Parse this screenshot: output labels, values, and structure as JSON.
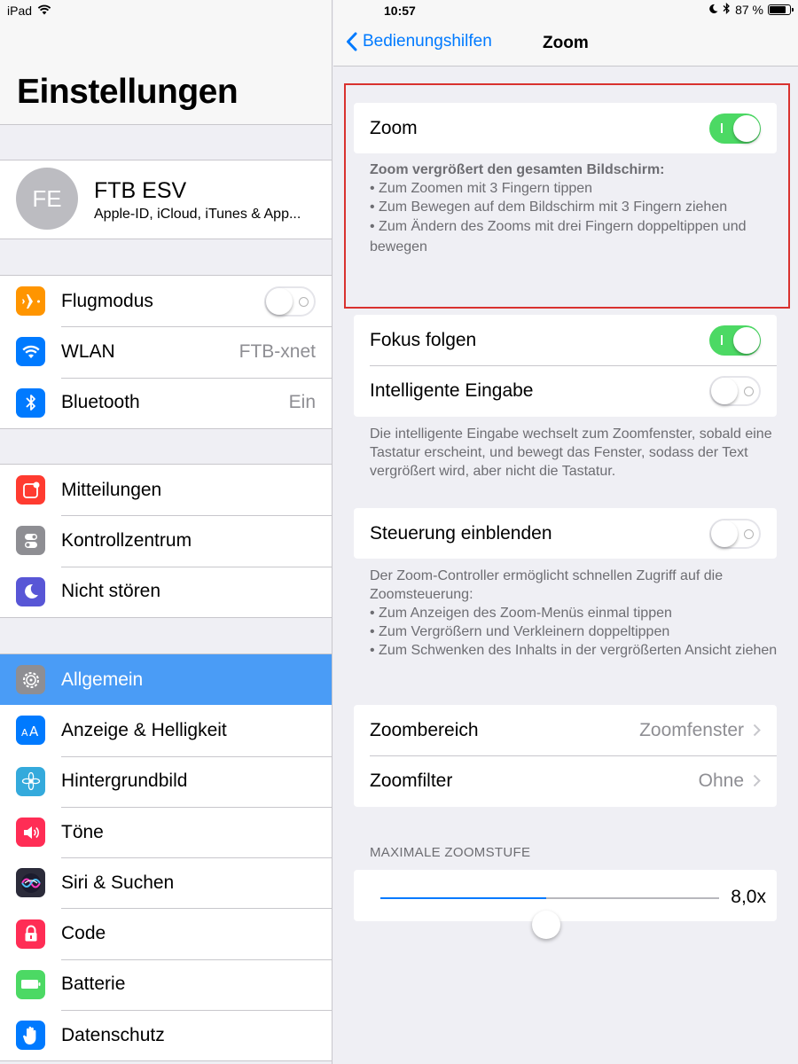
{
  "status_bar": {
    "device": "iPad",
    "time": "10:57",
    "battery_text": "87 %",
    "battery_level": 0.87
  },
  "sidebar": {
    "title": "Einstellungen",
    "profile": {
      "initials": "FE",
      "name": "FTB ESV",
      "subtitle": "Apple-ID, iCloud, iTunes & App..."
    },
    "group1": [
      {
        "label": "Flugmodus",
        "icon": "airplane-icon",
        "color": "#ff9500",
        "toggle": false
      },
      {
        "label": "WLAN",
        "icon": "wifi-icon",
        "color": "#007aff",
        "value": "FTB-xnet"
      },
      {
        "label": "Bluetooth",
        "icon": "bluetooth-icon",
        "color": "#007aff",
        "value": "Ein"
      }
    ],
    "group2": [
      {
        "label": "Mitteilungen",
        "icon": "notifications-icon",
        "color": "#ff3b30"
      },
      {
        "label": "Kontrollzentrum",
        "icon": "control-center-icon",
        "color": "#8e8e93"
      },
      {
        "label": "Nicht stören",
        "icon": "moon-icon",
        "color": "#5856d6"
      }
    ],
    "group3": [
      {
        "label": "Allgemein",
        "icon": "gear-icon",
        "color": "#8e8e93",
        "selected": true
      },
      {
        "label": "Anzeige & Helligkeit",
        "icon": "text-size-icon",
        "color": "#007aff"
      },
      {
        "label": "Hintergrundbild",
        "icon": "flower-icon",
        "color": "#34aadc"
      },
      {
        "label": "Töne",
        "icon": "speaker-icon",
        "color": "#ff2d55"
      },
      {
        "label": "Siri & Suchen",
        "icon": "siri-icon",
        "color": "#2b2b3a"
      },
      {
        "label": "Code",
        "icon": "lock-icon",
        "color": "#ff2d55"
      },
      {
        "label": "Batterie",
        "icon": "battery-icon",
        "color": "#4cd964"
      },
      {
        "label": "Datenschutz",
        "icon": "hand-icon",
        "color": "#007aff"
      }
    ]
  },
  "detail": {
    "back_label": "Bedienungshilfen",
    "title": "Zoom",
    "zoom_row": {
      "label": "Zoom",
      "on": true
    },
    "zoom_footnote": {
      "heading": "Zoom vergrößert den gesamten Bildschirm:",
      "lines": [
        "• Zum Zoomen mit 3 Fingern tippen",
        "• Zum Bewegen auf dem Bildschirm mit 3 Fingern ziehen",
        "• Zum Ändern des Zooms mit drei Fingern doppeltippen und bewegen"
      ]
    },
    "focus_row": {
      "label": "Fokus folgen",
      "on": true
    },
    "smart_typing_row": {
      "label": "Intelligente Eingabe",
      "on": false
    },
    "smart_typing_footnote": "Die intelligente Eingabe wechselt zum Zoomfenster, sobald eine Tastatur erscheint, und bewegt das Fenster, sodass der Text vergrößert wird, aber nicht die Tastatur.",
    "controller_row": {
      "label": "Steuerung einblenden",
      "on": false
    },
    "controller_footnote": {
      "intro": "Der Zoom-Controller ermöglicht schnellen Zugriff auf die Zoomsteuerung:",
      "lines": [
        "• Zum Anzeigen des Zoom-Menüs einmal tippen",
        "• Zum Vergrößern und Verkleinern doppeltippen",
        "• Zum Schwenken des Inhalts in der vergrößerten Ansicht ziehen"
      ]
    },
    "zoom_region": {
      "label": "Zoombereich",
      "value": "Zoomfenster"
    },
    "zoom_filter": {
      "label": "Zoomfilter",
      "value": "Ohne"
    },
    "max_zoom_header": "MAXIMALE ZOOMSTUFE",
    "max_zoom_value": "8,0x",
    "max_zoom_fraction": 0.49
  }
}
